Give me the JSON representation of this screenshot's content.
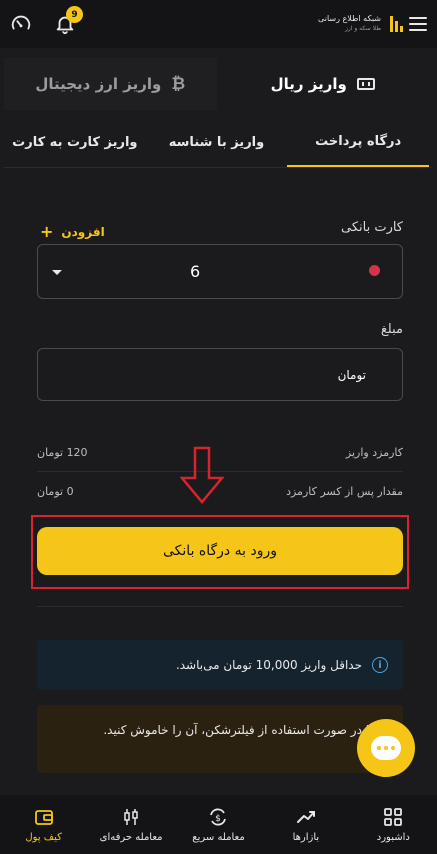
{
  "header": {
    "brand_name": "شبکه اطلاع رسانی",
    "brand_sub": "طلا سکه و ارز",
    "notification_count": "9",
    "icons": [
      "menu-icon",
      "logo-icon",
      "gauge-icon",
      "bell-icon"
    ]
  },
  "main_tabs": [
    {
      "label": "واریز ریال",
      "icon": "rial-icon",
      "active": true
    },
    {
      "label": "واریز ارز دیجیتال",
      "icon": "bitcoin-icon",
      "active": false
    }
  ],
  "sub_tabs": [
    {
      "label": "درگاه پرداخت",
      "active": true
    },
    {
      "label": "واریز با شناسه",
      "active": false
    },
    {
      "label": "واریز کارت به کارت",
      "active": false
    }
  ],
  "form": {
    "card_label": "کارت بانکی",
    "add_label": "افزودن",
    "add_icon": "+",
    "card_value": "6",
    "amount_label": "مبلغ",
    "amount_unit": "تومان"
  },
  "fees": {
    "fee_label": "کارمزد واریز",
    "fee_value": "120 تومان",
    "net_label": "مقدار پس از کسر کارمزد",
    "net_value": "0 تومان"
  },
  "gateway_button": "ورود به درگاه بانکی",
  "info": {
    "icon": "i",
    "text": "حداقل واریز 10,000 تومان می‌باشد."
  },
  "warning": {
    "text": "لطفا در صورت استفاده از فیلترشکن، آن را خاموش کنید."
  },
  "bottom_nav": [
    {
      "label": "داشبورد",
      "icon": "dashboard-icon"
    },
    {
      "label": "بازارها",
      "icon": "markets-icon"
    },
    {
      "label": "معامله سریع",
      "icon": "quick-trade-icon"
    },
    {
      "label": "معامله حرفه‌ای",
      "icon": "pro-trade-icon"
    },
    {
      "label": "کیف پول",
      "icon": "wallet-icon",
      "active": true
    }
  ],
  "colors": {
    "accent": "#f5c518",
    "background": "#1b1b1e",
    "highlight": "#d9232e",
    "info": "#4aa3e0"
  }
}
